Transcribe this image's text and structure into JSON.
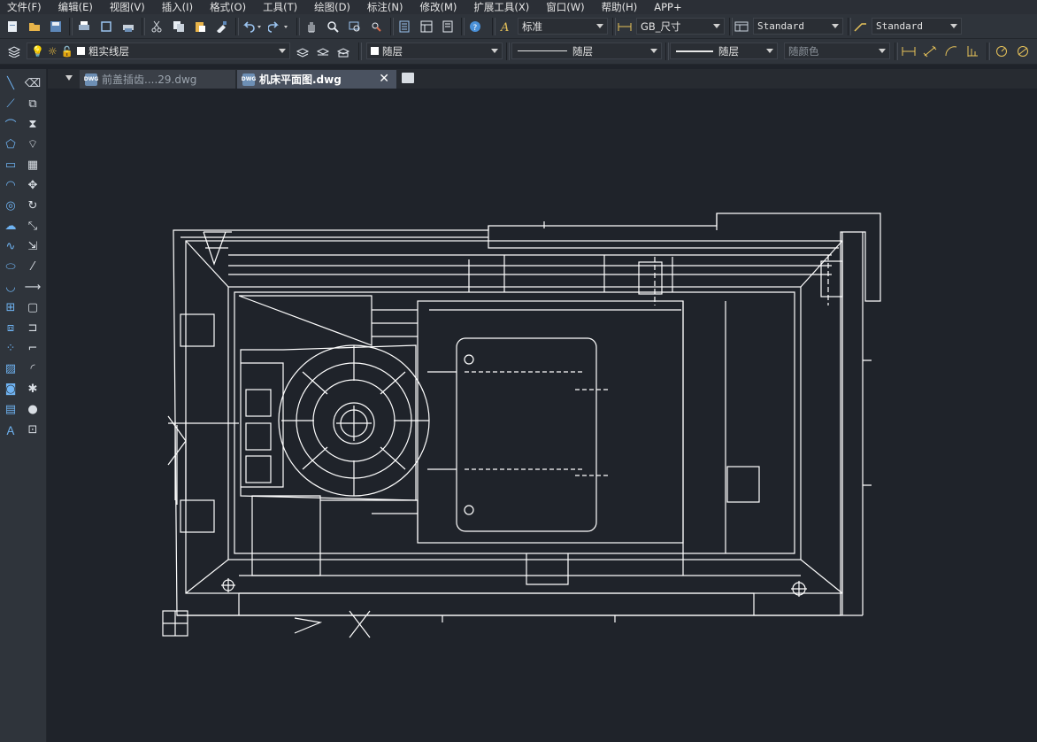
{
  "menu": [
    "文件(F)",
    "编辑(E)",
    "视图(V)",
    "插入(I)",
    "格式(O)",
    "工具(T)",
    "绘图(D)",
    "标注(N)",
    "修改(M)",
    "扩展工具(X)",
    "窗口(W)",
    "帮助(H)",
    "APP+"
  ],
  "styles": {
    "text_style": "标准",
    "dim_style": "GB_尺寸",
    "table_style": "Standard",
    "mleader_style": "Standard"
  },
  "layers": {
    "current_layer": "粗实线层",
    "color": "随层",
    "linetype": "随层",
    "lineweight": "随层",
    "plot_style": "随颜色"
  },
  "tabs": [
    {
      "label": "前盖插齿....29.dwg",
      "active": false
    },
    {
      "label": "机床平面图.dwg",
      "active": true
    }
  ],
  "file_icon_text": "DWG",
  "tab_close_glyph": "✕",
  "colors": {
    "background": "#1f232a",
    "toolbar": "#2f343b",
    "drawing_lines": "#ffffff",
    "accent": "#e8c35a"
  },
  "icons": {
    "toolbar1": [
      "new-file-icon",
      "open-folder-icon",
      "save-icon",
      "print-icon",
      "print-preview-icon",
      "plot-icon",
      "cut-icon",
      "copy-icon",
      "paste-icon",
      "match-properties-icon",
      "undo-icon",
      "redo-icon",
      "pan-icon",
      "zoom-realtime-icon",
      "zoom-window-icon",
      "zoom-previous-icon",
      "properties-icon",
      "design-center-icon",
      "tool-palette-icon",
      "help-icon",
      "text-style-icon",
      "dim-style-icon",
      "table-style-icon",
      "mleader-style-icon"
    ],
    "toolbar2": [
      "layer-manager-icon",
      "layer-state-icons",
      "make-current-icon",
      "layer-previous-icon",
      "layer-isolate-icon"
    ],
    "leftbar": [
      "line-icon",
      "erase-icon",
      "xline-icon",
      "copy-icon",
      "polyline-icon",
      "mirror-icon",
      "polygon-icon",
      "offset-icon",
      "rectangle-icon",
      "array-icon",
      "arc-icon",
      "move-icon",
      "circle-icon",
      "rotate-icon",
      "revcloud-icon",
      "scale-icon",
      "spline-icon",
      "stretch-icon",
      "ellipse-icon",
      "trim-icon",
      "ellipse-arc-icon",
      "extend-icon",
      "insert-block-icon",
      "break-icon",
      "make-block-icon",
      "join-icon",
      "point-icon",
      "chamfer-icon",
      "hatch-icon",
      "fillet-icon",
      "region-icon",
      "explode-icon",
      "table-icon",
      "sphere-icon",
      "mtext-icon",
      "block-attr-icon"
    ]
  }
}
